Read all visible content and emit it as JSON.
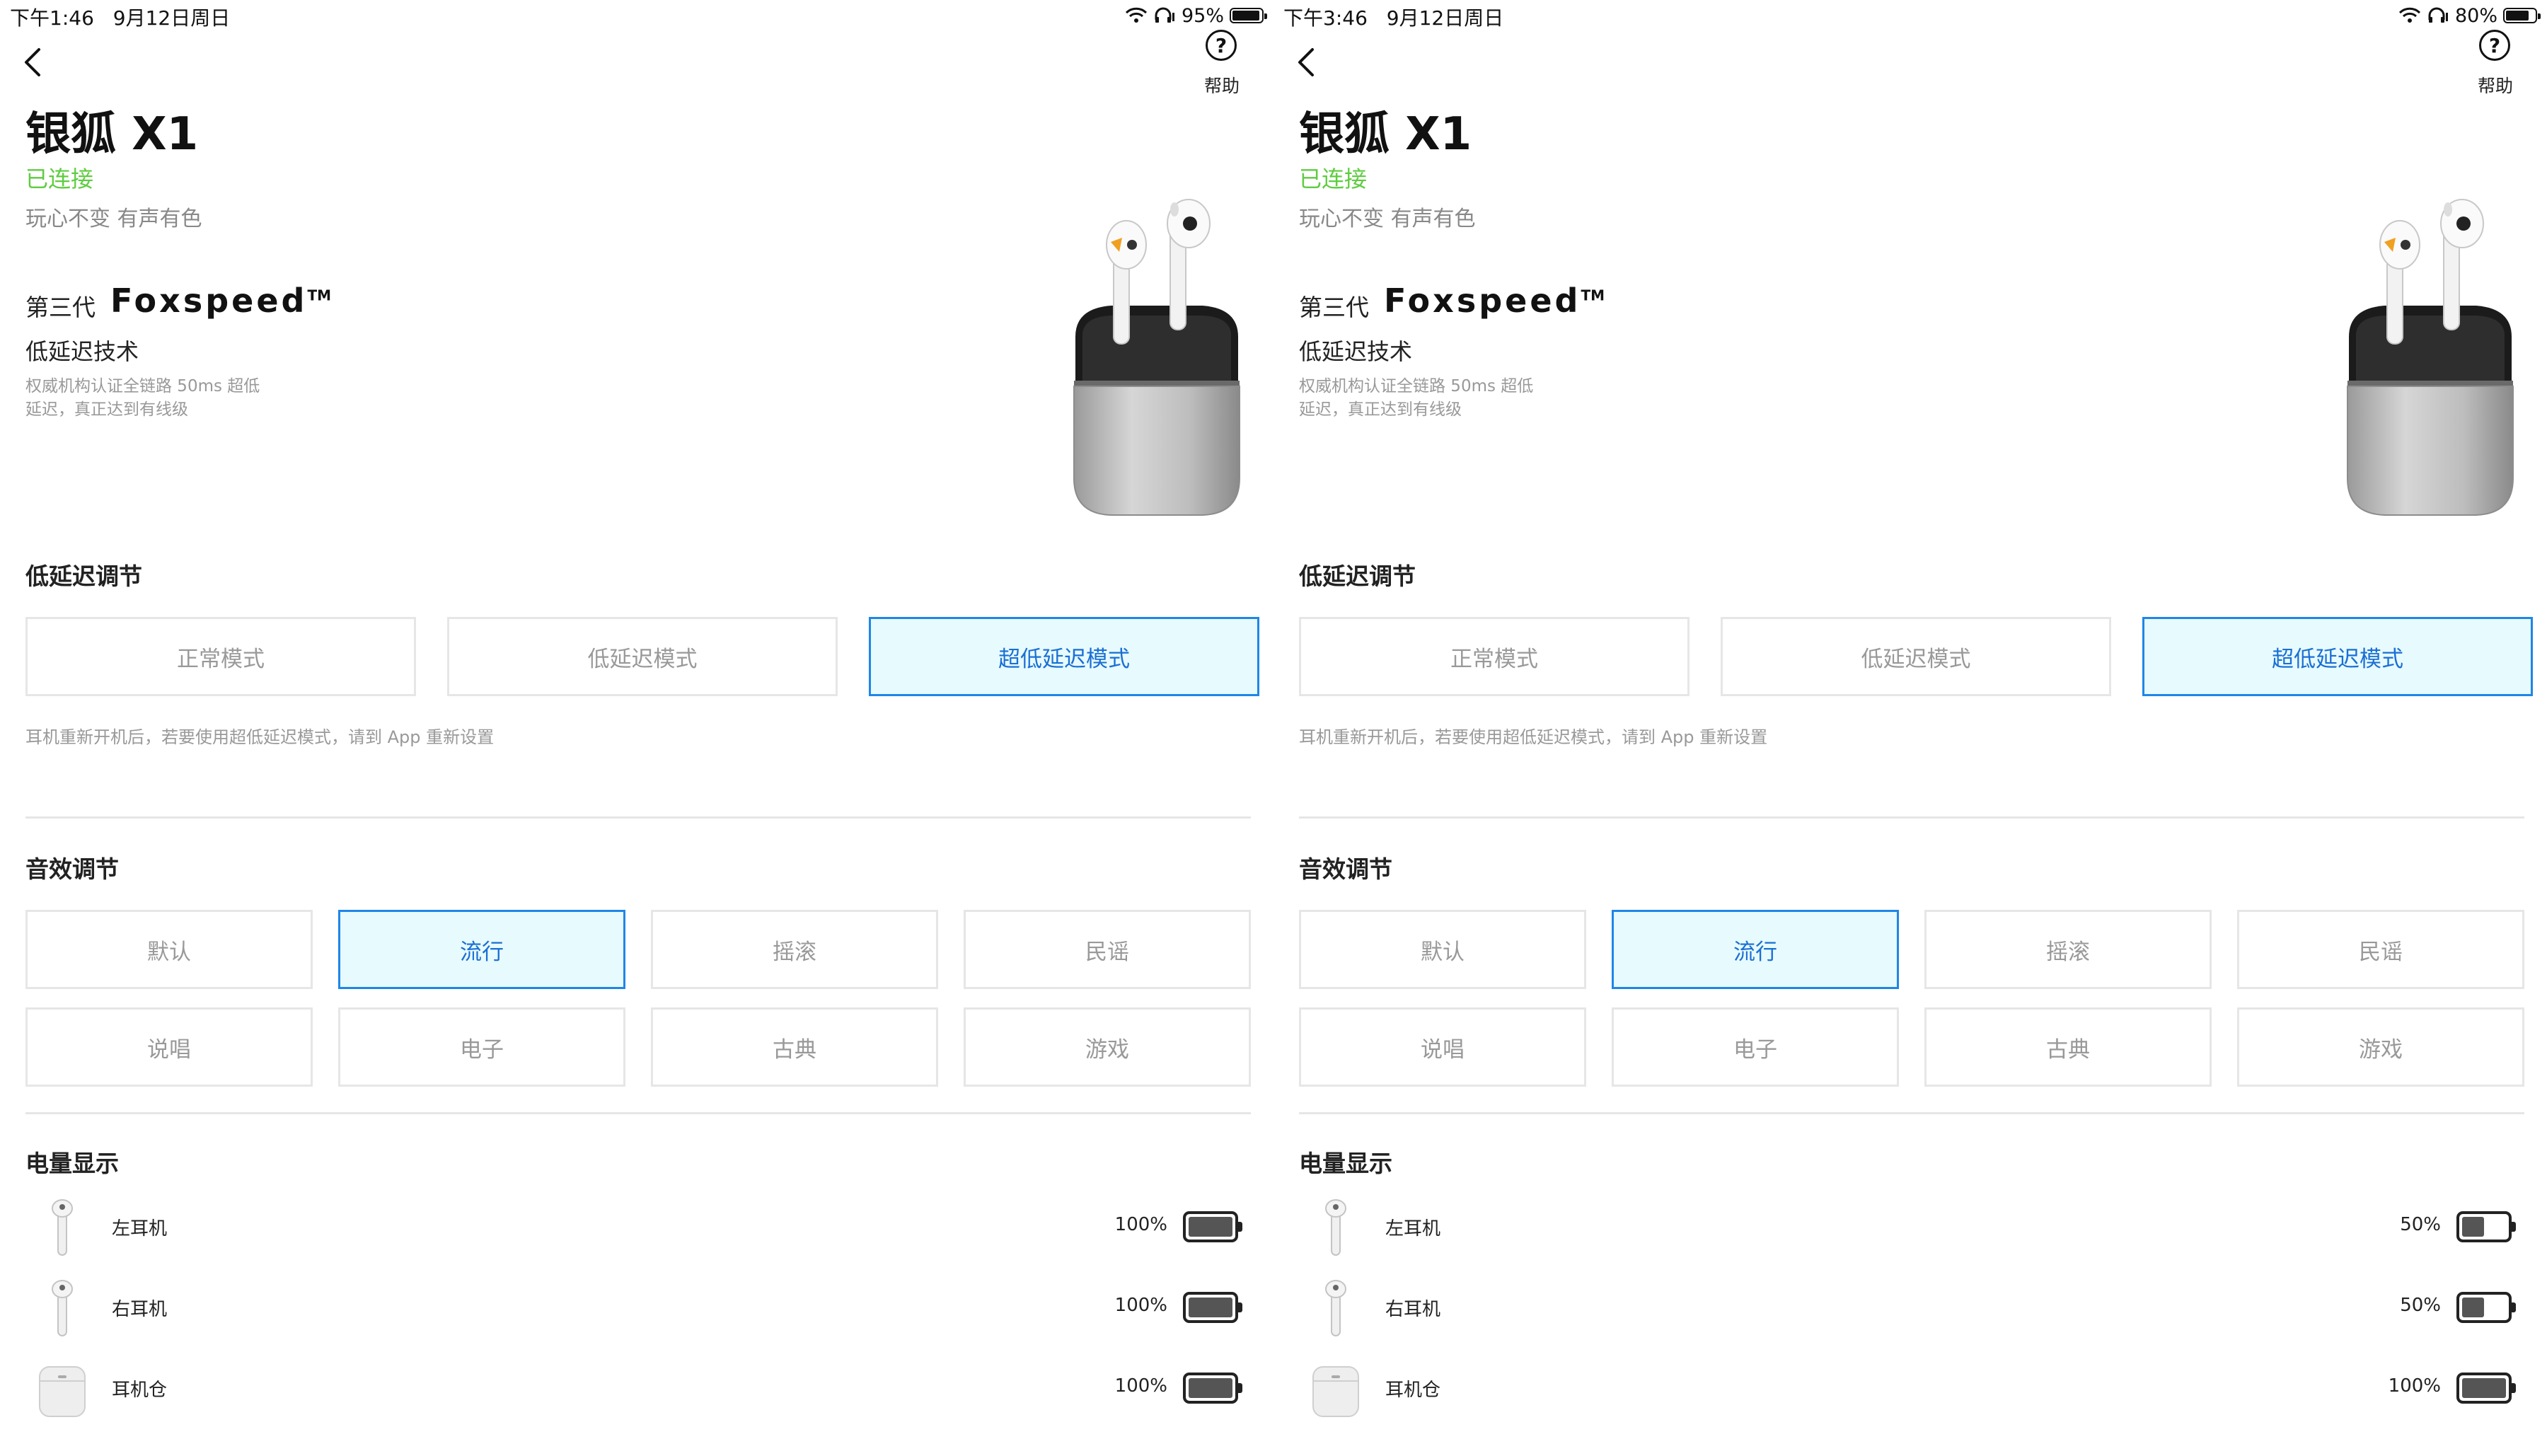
{
  "panels": [
    {
      "status_bar": {
        "time": "下午1:46",
        "date": "9月12日周日",
        "battery": "95%",
        "battery_level": 0.95
      },
      "help_label": "帮助",
      "device": {
        "name": "银狐 X1",
        "status": "已连接",
        "slogan": "玩心不变 有声有色"
      },
      "tech": {
        "generation": "第三代",
        "brand": "Foxspeed",
        "trademark": "TM",
        "title": "低延迟技术",
        "desc_line1": "权威机构认证全链路 50ms 超低",
        "desc_line2": "延迟，真正达到有线级"
      },
      "latency": {
        "title": "低延迟调节",
        "modes": [
          "正常模式",
          "低延迟模式",
          "超低延迟模式"
        ],
        "selected_index": 2,
        "note": "耳机重新开机后，若要使用超低延迟模式，请到 App 重新设置"
      },
      "eq": {
        "title": "音效调节",
        "presets": [
          "默认",
          "流行",
          "摇滚",
          "民谣",
          "说唱",
          "电子",
          "古典",
          "游戏"
        ],
        "selected_index": 1
      },
      "power": {
        "title": "电量显示",
        "items": [
          {
            "label": "左耳机",
            "percent": "100%",
            "level": 1.0
          },
          {
            "label": "右耳机",
            "percent": "100%",
            "level": 1.0
          },
          {
            "label": "耳机仓",
            "percent": "100%",
            "level": 1.0
          }
        ]
      }
    },
    {
      "status_bar": {
        "time": "下午3:46",
        "date": "9月12日周日",
        "battery": "80%",
        "battery_level": 0.8
      },
      "help_label": "帮助",
      "device": {
        "name": "银狐 X1",
        "status": "已连接",
        "slogan": "玩心不变 有声有色"
      },
      "tech": {
        "generation": "第三代",
        "brand": "Foxspeed",
        "trademark": "TM",
        "title": "低延迟技术",
        "desc_line1": "权威机构认证全链路 50ms 超低",
        "desc_line2": "延迟，真正达到有线级"
      },
      "latency": {
        "title": "低延迟调节",
        "modes": [
          "正常模式",
          "低延迟模式",
          "超低延迟模式"
        ],
        "selected_index": 2,
        "note": "耳机重新开机后，若要使用超低延迟模式，请到 App 重新设置"
      },
      "eq": {
        "title": "音效调节",
        "presets": [
          "默认",
          "流行",
          "摇滚",
          "民谣",
          "说唱",
          "电子",
          "古典",
          "游戏"
        ],
        "selected_index": 1
      },
      "power": {
        "title": "电量显示",
        "items": [
          {
            "label": "左耳机",
            "percent": "50%",
            "level": 0.5
          },
          {
            "label": "右耳机",
            "percent": "50%",
            "level": 0.5
          },
          {
            "label": "耳机仓",
            "percent": "100%",
            "level": 1.0
          }
        ]
      }
    }
  ],
  "colors": {
    "connected": "#5fcc40",
    "selected_border": "#1f86e8",
    "selected_bg": "#e7fafd",
    "selected_text": "#1a6fd4"
  }
}
